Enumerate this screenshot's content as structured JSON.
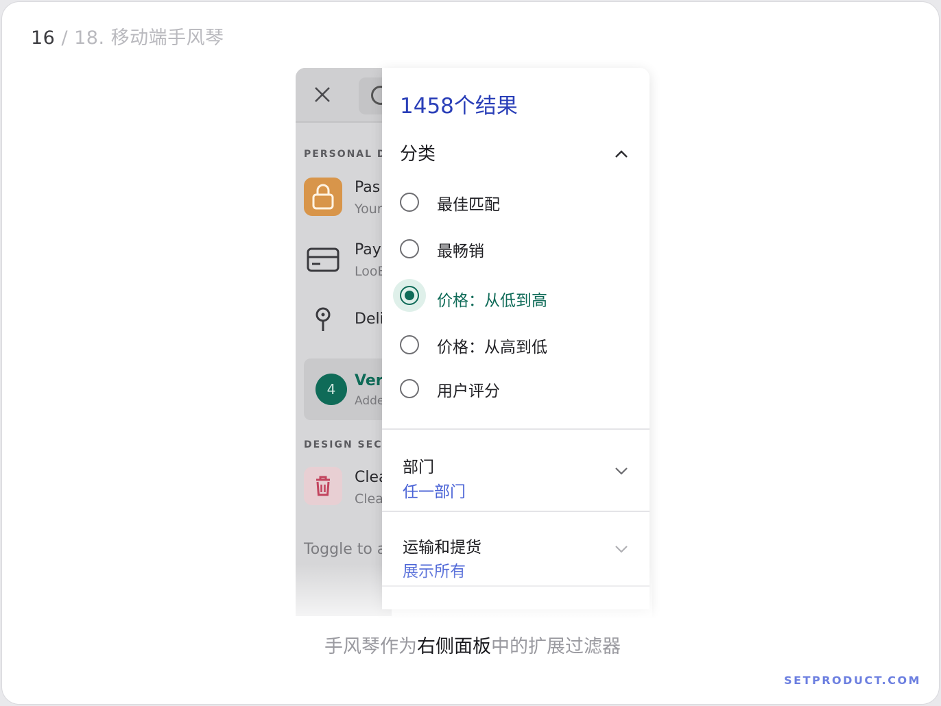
{
  "slide": {
    "current": "16",
    "rest": " / 18. 移动端手风琴"
  },
  "background_screen": {
    "section1": "PERSONAL DE",
    "items": [
      {
        "title": "Pas",
        "subtitle": "Your"
      },
      {
        "title": "Pay",
        "subtitle": "LooE"
      },
      {
        "title": "Deli",
        "subtitle": ""
      }
    ],
    "version": {
      "badge": "4",
      "title": "Vers",
      "subtitle": "Adde"
    },
    "section2": "DESIGN SECU",
    "clear": {
      "title": "Clea",
      "subtitle": "Clea"
    },
    "toggle": "Toggle to a"
  },
  "panel": {
    "results": "1458个结果",
    "category_title": "分类",
    "options": [
      {
        "label": "最佳匹配",
        "selected": false
      },
      {
        "label": "最畅销",
        "selected": false
      },
      {
        "label": "价格：从低到高",
        "selected": true
      },
      {
        "label": "价格：从高到低",
        "selected": false
      },
      {
        "label": "用户评分",
        "selected": false
      }
    ],
    "department": {
      "title": "部门",
      "value": "任一部门"
    },
    "shipping": {
      "title": "运输和提货",
      "value": "展示所有"
    }
  },
  "caption": {
    "before": "手风琴作为",
    "strong": "右侧面板",
    "after": "中的扩展过滤器"
  },
  "brand": "SETPRODUCT.COM",
  "colors": {
    "accent_green": "#0f6b58",
    "results_blue": "#2a3fb8",
    "link_blue": "#4a63d6",
    "lock_orange": "#d8954a",
    "trash_red": "#c2445e"
  }
}
